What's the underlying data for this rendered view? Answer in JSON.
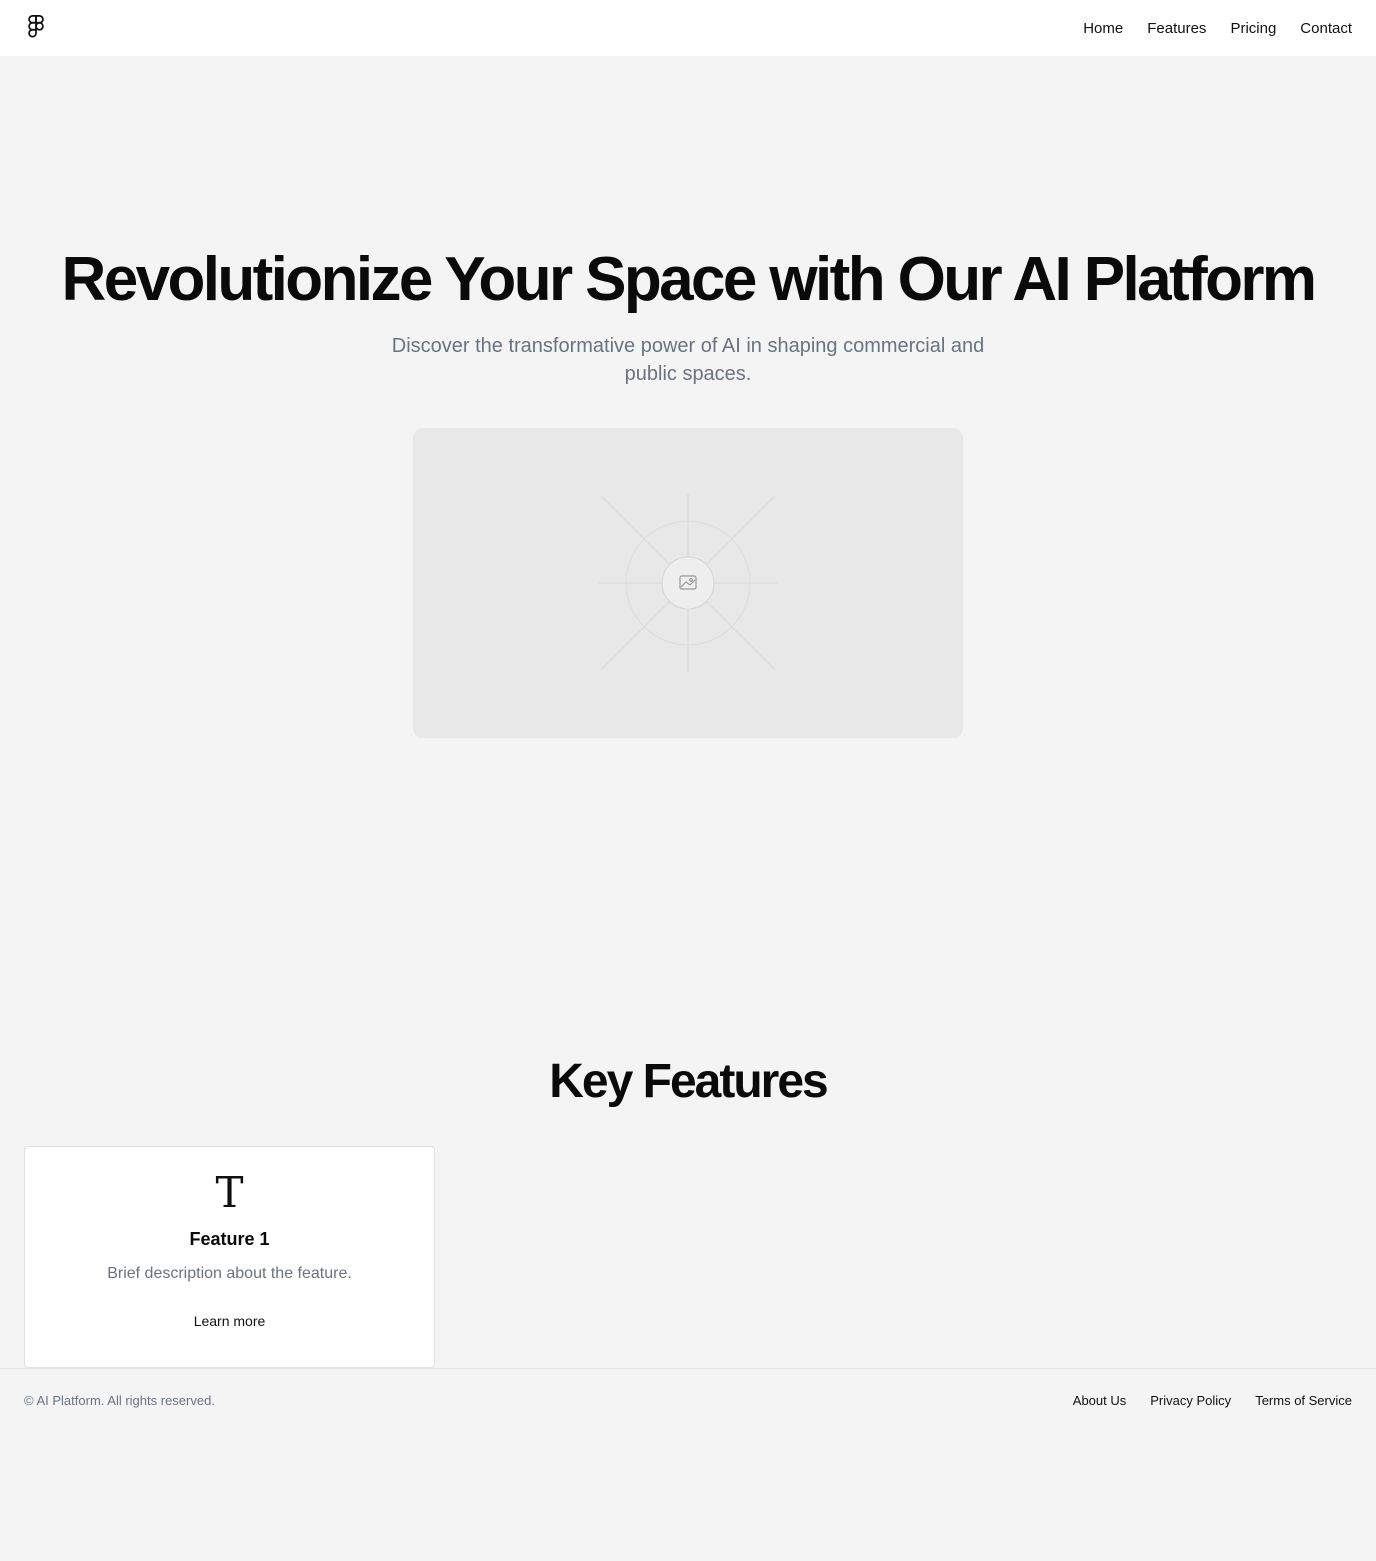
{
  "nav": {
    "logo_icon": "figma-logo-icon",
    "links": [
      "Home",
      "Features",
      "Pricing",
      "Contact"
    ]
  },
  "hero": {
    "title": "Revolutionize Your Space with Our AI Platform",
    "subtitle": "Discover the transformative power of AI in shaping commercial and public spaces.",
    "image_icon": "image-placeholder-icon"
  },
  "features": {
    "title": "Key Features",
    "cards": [
      {
        "icon": "T",
        "title": "Feature 1",
        "description": "Brief description about the feature.",
        "link": "Learn more"
      }
    ]
  },
  "footer": {
    "copyright": "© AI Platform. All rights reserved.",
    "links": [
      "About Us",
      "Privacy Policy",
      "Terms of Service"
    ]
  },
  "colors": {
    "background": "#f4f4f4",
    "surface": "#ffffff",
    "text": "#0a0a0a",
    "muted": "#6b7280",
    "placeholder": "#e8e8e8"
  }
}
